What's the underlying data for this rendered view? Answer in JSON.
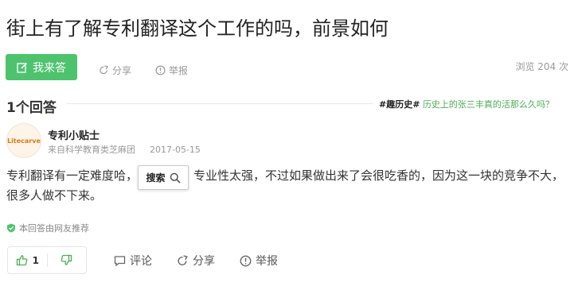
{
  "question": {
    "title": "街上有了解专利翻译这个工作的吗，前景如何"
  },
  "actions": {
    "answer_label": "我来答",
    "share_label": "分享",
    "report_label": "举报",
    "views": "浏览 204 次"
  },
  "answers_header": {
    "count": "1个回答",
    "topic_tag": "#趣历史#",
    "topic_link": "历史上的张三丰真的活那么久吗？"
  },
  "answer": {
    "logo_text": "Litecarve",
    "author": "专利小贴士",
    "source": "来自科学教育类芝麻团",
    "date": "2017-05-15",
    "text_before": "专利翻译有一定难度哈，",
    "text_after": "专业性太强，不过如果做出来了会很吃香的，因为这一块的竞争不大，很多人做不下来。",
    "recommend": "本回答由网友推荐"
  },
  "search_popup": {
    "label": "搜索"
  },
  "footer": {
    "like_count": "1",
    "comment_label": "评论",
    "share_label": "分享",
    "report_label": "举报"
  },
  "colors": {
    "accent": "#4dc36e",
    "link": "#4dae56"
  }
}
